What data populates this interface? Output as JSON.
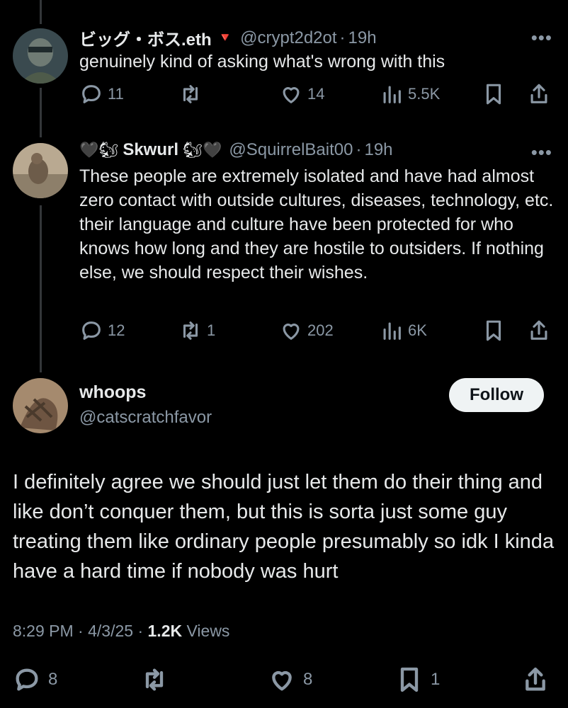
{
  "tweets": [
    {
      "name": "ビッグ・ボス.eth",
      "name_suffix": "🔻",
      "handle": "@crypt2d2ot",
      "time": "19h",
      "text": "genuinely kind of asking what's wrong with this",
      "replies": "11",
      "retweets": "",
      "likes": "14",
      "views": "5.5K"
    },
    {
      "name_prefix": "🖤🐿",
      "name": "Skwurl",
      "name_suffix": "🐿🖤",
      "handle": "@SquirrelBait00",
      "time": "19h",
      "text": "These people are extremely isolated and have had almost zero contact with outside cultures, diseases, technology, etc. their language and culture have been protected for who knows how long and they are hostile to outsiders. If nothing else, we should respect their wishes.",
      "replies": "12",
      "retweets": "1",
      "likes": "202",
      "views": "6K"
    }
  ],
  "main": {
    "name": "whoops",
    "handle": "@catscratchfavor",
    "follow_label": "Follow",
    "text": "I definitely agree we should just let them do their thing and like don’t conquer them, but this is sorta just some guy treating them like ordinary people presumably so idk I kinda have a hard time if nobody was hurt",
    "time": "8:29 PM",
    "date": "4/3/25",
    "views_count": "1.2K",
    "views_label": "Views",
    "replies": "8",
    "retweets": "",
    "likes": "8",
    "bookmarks": "1"
  },
  "separator": "·",
  "more_glyph": "•••",
  "icons": [
    "reply-icon",
    "retweet-icon",
    "like-icon",
    "views-icon",
    "bookmark-icon",
    "share-icon"
  ],
  "colors": {
    "background": "#000000",
    "text": "#e7e9ea",
    "secondary": "#8b98a5",
    "follow_bg": "#eff3f4"
  }
}
